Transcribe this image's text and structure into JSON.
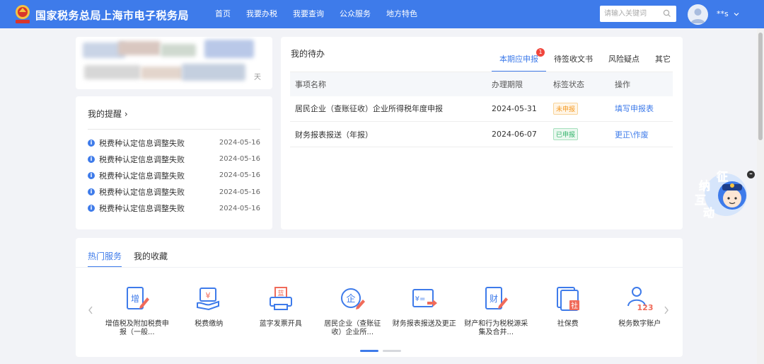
{
  "header": {
    "site_title": "国家税务总局上海市电子税务局",
    "nav": [
      "首页",
      "我要办税",
      "我要查询",
      "公众服务",
      "地方特色"
    ],
    "search_placeholder": "请输入关键词",
    "user_name": "**s"
  },
  "user_card": {
    "corner_char": "天"
  },
  "reminders": {
    "title": "我的提醒 ›",
    "items": [
      {
        "text": "税费种认定信息调整失败",
        "date": "2024-05-16"
      },
      {
        "text": "税费种认定信息调整失败",
        "date": "2024-05-16"
      },
      {
        "text": "税费种认定信息调整失败",
        "date": "2024-05-16"
      },
      {
        "text": "税费种认定信息调整失败",
        "date": "2024-05-16"
      },
      {
        "text": "税费种认定信息调整失败",
        "date": "2024-05-16"
      }
    ]
  },
  "todo": {
    "title": "我的待办",
    "tabs": [
      {
        "label": "本期应申报",
        "badge": "1"
      },
      {
        "label": "待签收文书"
      },
      {
        "label": "风险疑点"
      },
      {
        "label": "其它"
      }
    ],
    "columns": [
      "事项名称",
      "办理期限",
      "标签状态",
      "操作"
    ],
    "rows": [
      {
        "name": "居民企业（查账征收）企业所得税年度申报",
        "deadline": "2024-05-31",
        "status": "未申报",
        "status_type": "pending",
        "action": "填写申报表"
      },
      {
        "name": "财务报表报送（年报）",
        "deadline": "2024-06-07",
        "status": "已申报",
        "status_type": "done",
        "action": "更正\\作废"
      }
    ]
  },
  "services": {
    "tabs": [
      "热门服务",
      "我的收藏"
    ],
    "items": [
      {
        "label": "增值税及附加税费申报（一般...",
        "icon": "vat-declare-icon",
        "glyph": "增"
      },
      {
        "label": "税费缴纳",
        "icon": "tax-payment-icon",
        "glyph": "¥"
      },
      {
        "label": "蓝字发票开具",
        "icon": "invoice-print-icon",
        "glyph": "蓝"
      },
      {
        "label": "居民企业（查账征收）企业所...",
        "icon": "enterprise-tax-icon",
        "glyph": "企"
      },
      {
        "label": "财务报表报送及更正",
        "icon": "financial-report-icon",
        "glyph": "¥="
      },
      {
        "label": "财产和行为税税源采集及合并...",
        "icon": "property-tax-icon",
        "glyph": "财"
      },
      {
        "label": "社保费",
        "icon": "social-security-icon",
        "glyph": "社"
      },
      {
        "label": "税务数字账户",
        "icon": "digital-account-icon",
        "glyph": "123"
      }
    ]
  },
  "float_widget": {
    "chars": [
      "征",
      "纳",
      "互",
      "动"
    ],
    "close": "–"
  },
  "colors": {
    "primary": "#3e7bea",
    "badge": "#f0463c",
    "pending": "#f59a23",
    "done": "#34b36b"
  }
}
